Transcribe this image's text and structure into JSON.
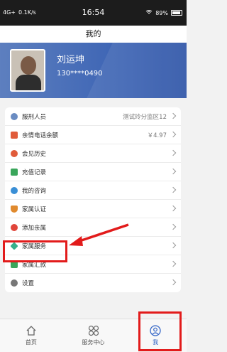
{
  "statusbar": {
    "signal": "4G+",
    "speed": "0.1K/s",
    "time": "16:54",
    "battery": "89%"
  },
  "header": {
    "title": "我的"
  },
  "profile": {
    "name": "刘运坤",
    "phone": "130****0490"
  },
  "menu": {
    "items": [
      {
        "label": "服刑人员",
        "value": "测试玲分监区12",
        "icon_color": "#6a8cc2"
      },
      {
        "label": "亲情电话余额",
        "value": "￥4.97",
        "icon_color": "#e05b3a"
      },
      {
        "label": "会见历史",
        "value": "",
        "icon_color": "#e05b3a"
      },
      {
        "label": "充值记录",
        "value": "",
        "icon_color": "#3aa65b"
      },
      {
        "label": "我的咨询",
        "value": "",
        "icon_color": "#3a8fd6"
      },
      {
        "label": "家属认证",
        "value": "",
        "icon_color": "#e08a2e"
      },
      {
        "label": "添加亲属",
        "value": "",
        "icon_color": "#e0453a"
      },
      {
        "label": "家属服务",
        "value": "",
        "icon_color": "#37b08b"
      },
      {
        "label": "家属汇款",
        "value": "",
        "icon_color": "#3aa65b"
      },
      {
        "label": "设置",
        "value": "",
        "icon_color": "#777777"
      }
    ]
  },
  "tabs": [
    {
      "label": "首页",
      "icon": "home-icon"
    },
    {
      "label": "服务中心",
      "icon": "grid-icon"
    },
    {
      "label": "我",
      "icon": "person-icon"
    }
  ],
  "colors": {
    "accent": "#3466c7",
    "highlight": "#e21b1b",
    "hero": "#3f66b5"
  }
}
